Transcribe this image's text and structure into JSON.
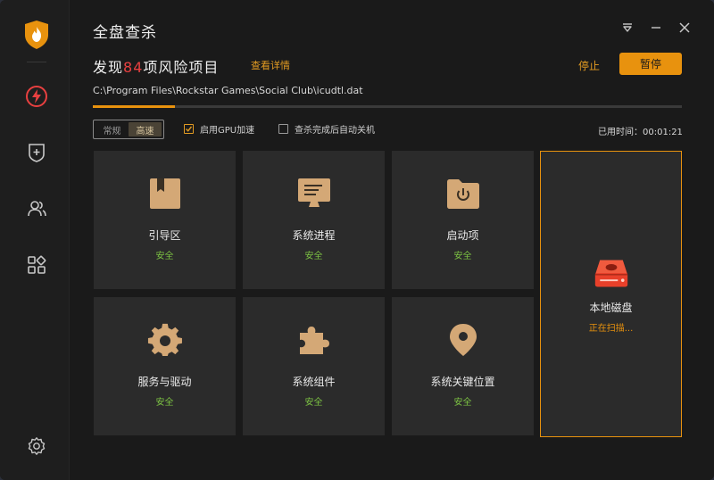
{
  "window": {
    "title": "全盘查杀"
  },
  "scan": {
    "found_prefix": "发现",
    "found_count": "84",
    "found_suffix": "项风险项目",
    "details_link": "查看详情",
    "stop_label": "停止",
    "pause_label": "暂停",
    "current_path": "C:\\Program Files\\Rockstar Games\\Social Club\\icudtl.dat",
    "progress_fraction": 0.14
  },
  "options": {
    "mode_normal": "常规",
    "mode_fast": "高速",
    "active_mode": "fast",
    "gpu_label": "启用GPU加速",
    "gpu_checked": true,
    "shutdown_label": "查杀完成后自动关机",
    "shutdown_checked": false,
    "elapsed_label": "已用时间：",
    "elapsed_value": "00:01:21"
  },
  "items": [
    {
      "name": "引导区",
      "status": "安全",
      "icon": "bookmark-folder-icon"
    },
    {
      "name": "系统进程",
      "status": "安全",
      "icon": "monitor-icon"
    },
    {
      "name": "启动项",
      "status": "安全",
      "icon": "power-folder-icon"
    },
    {
      "name": "服务与驱动",
      "status": "安全",
      "icon": "gear-icon"
    },
    {
      "name": "系统组件",
      "status": "安全",
      "icon": "puzzle-icon"
    },
    {
      "name": "系统关键位置",
      "status": "安全",
      "icon": "location-pin-icon"
    },
    {
      "name": "本地磁盘",
      "status": "正在扫描...",
      "icon": "hard-disk-icon"
    }
  ],
  "colors": {
    "accent": "#e8920e",
    "danger": "#e84040",
    "safe": "#7cc243",
    "icon_tan": "#d4a876",
    "disk_red": "#e8402a"
  }
}
